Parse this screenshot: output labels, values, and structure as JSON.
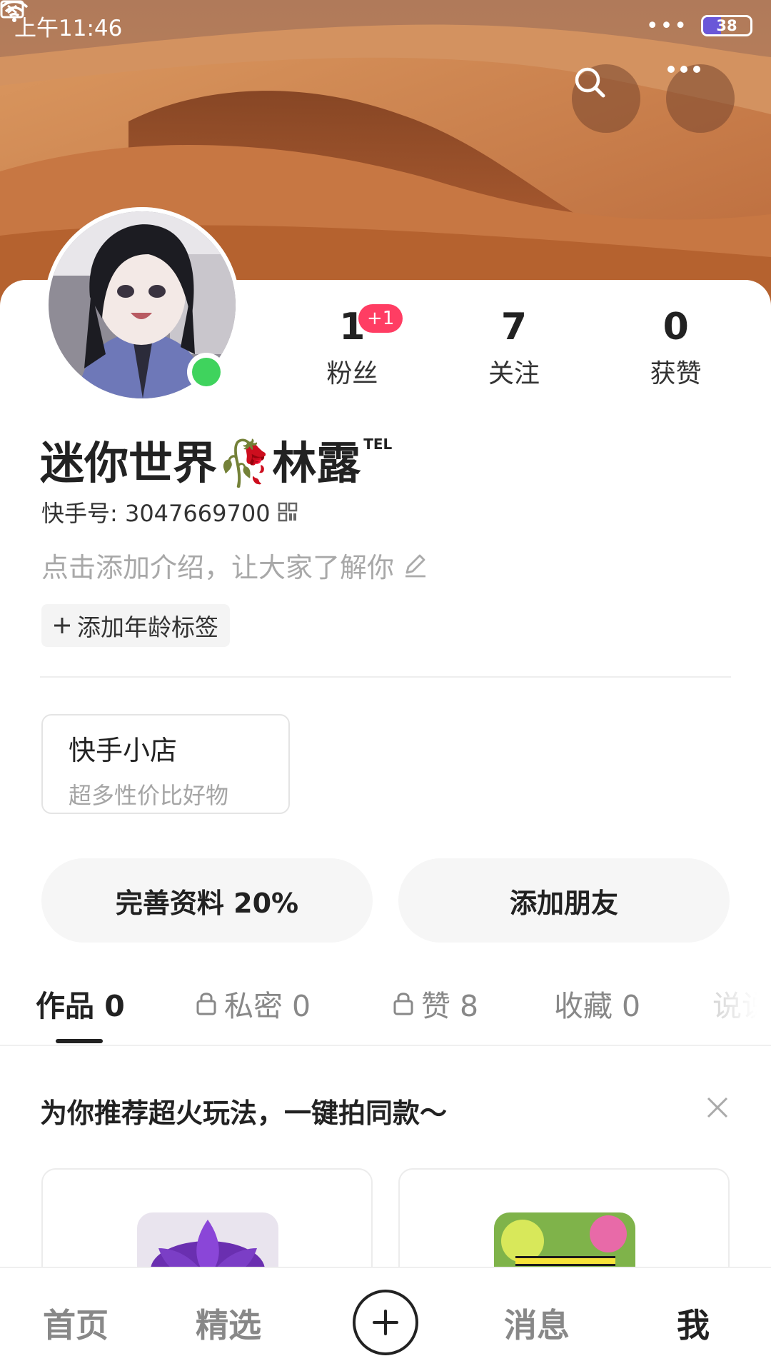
{
  "status_bar": {
    "time": "上午11:46",
    "battery": "38",
    "battery_fraction": 0.38
  },
  "profile": {
    "nickname": "迷你世界🥀林露",
    "nickname_sup": "TEL",
    "uid_label": "快手号: 3047669700",
    "intro_placeholder": "点击添加介绍，让大家了解你",
    "age_tag": "添加年龄标签"
  },
  "stats": [
    {
      "value": "1",
      "label": "粉丝",
      "badge": "+1"
    },
    {
      "value": "7",
      "label": "关注"
    },
    {
      "value": "0",
      "label": "获赞"
    }
  ],
  "shop": {
    "title": "快手小店",
    "subtitle": "超多性价比好物"
  },
  "actions": {
    "complete_profile": "完善资料 20%",
    "add_friends": "添加朋友"
  },
  "tabs": [
    {
      "label": "作品 0",
      "locked": false,
      "active": true
    },
    {
      "label": "私密 0",
      "locked": true,
      "active": false
    },
    {
      "label": "赞 8",
      "locked": true,
      "active": false
    },
    {
      "label": "收藏 0",
      "locked": false,
      "active": false
    },
    {
      "label": "说说",
      "locked": false,
      "active": false
    }
  ],
  "recommend": {
    "title": "为你推荐超火玩法，一键拍同款～"
  },
  "bottom_nav": {
    "home": "首页",
    "featured": "精选",
    "messages": "消息",
    "me": "我"
  },
  "colors": {
    "online": "#3fd35d",
    "badge": "#ff3d63",
    "battery": "#6a57d8"
  }
}
